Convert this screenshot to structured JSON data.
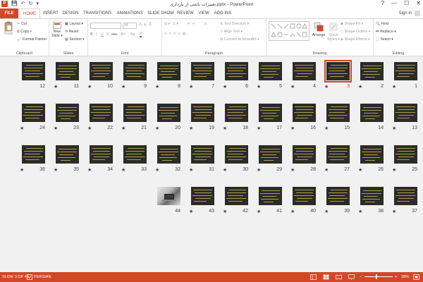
{
  "window": {
    "title": "تغییرات ناشی از بارداری.pptx - PowerPoint",
    "help": "?",
    "min": "—",
    "max": "☐",
    "close": "✕"
  },
  "quick_access": {
    "app_icon": "P",
    "save": "💾",
    "undo": "↶",
    "redo": "↻",
    "customize": "▾"
  },
  "tabs": [
    "FILE",
    "HOME",
    "INSERT",
    "DESIGN",
    "TRANSITIONS",
    "ANIMATIONS",
    "SLIDE SHOW",
    "REVIEW",
    "VIEW",
    "ADD-INS"
  ],
  "sign_in": "Sign in",
  "ribbon": {
    "clipboard": {
      "paste": "Paste",
      "cut": "Cut",
      "copy": "Copy ▾",
      "format_painter": "Format Painter",
      "label": "Clipboard"
    },
    "slides": {
      "new_slide": "New",
      "new_slide2": "Slide ▾",
      "layout": "Layout ▾",
      "reset": "Reset",
      "section": "Section ▾",
      "label": "Slides"
    },
    "font": {
      "size": "44",
      "bold": "B",
      "italic": "I",
      "underline": "U",
      "strike": "S",
      "shadow": "abc",
      "spacing": "AV",
      "case": "Aa",
      "color": "A",
      "grow": "A",
      "shrink": "A",
      "clear": "A",
      "label": "Font"
    },
    "paragraph": {
      "text_direction": "Text Direction ▾",
      "align_text": "Align Text ▾",
      "smartart": "Convert to SmartArt ▾",
      "label": "Paragraph"
    },
    "drawing": {
      "arrange": "Arrange",
      "quick_styles": "Quick",
      "quick_styles2": "Styles ▾",
      "shape_fill": "Shape Fill ▾",
      "shape_outline": "Shape Outline ▾",
      "shape_effects": "Shape Effects ▾",
      "label": "Drawing"
    },
    "editing": {
      "find": "Find",
      "replace": "Replace ▾",
      "select": "Select ▾",
      "label": "Editing"
    }
  },
  "slides": [
    {
      "n": 1,
      "star": true,
      "sel": false,
      "photo": false
    },
    {
      "n": 2,
      "star": true,
      "sel": false,
      "photo": false
    },
    {
      "n": 3,
      "star": true,
      "sel": true,
      "photo": false
    },
    {
      "n": 4,
      "star": true,
      "sel": false,
      "photo": false
    },
    {
      "n": 5,
      "star": true,
      "sel": false,
      "photo": false
    },
    {
      "n": 6,
      "star": true,
      "sel": false,
      "photo": false
    },
    {
      "n": 7,
      "star": true,
      "sel": false,
      "photo": false
    },
    {
      "n": 8,
      "star": true,
      "sel": false,
      "photo": false
    },
    {
      "n": 9,
      "star": true,
      "sel": false,
      "photo": false
    },
    {
      "n": 10,
      "star": true,
      "sel": false,
      "photo": false
    },
    {
      "n": 11,
      "star": true,
      "sel": false,
      "photo": false
    },
    {
      "n": 12,
      "star": false,
      "sel": false,
      "photo": false
    },
    {
      "n": 13,
      "star": true,
      "sel": false,
      "photo": false
    },
    {
      "n": 14,
      "star": false,
      "sel": false,
      "photo": false
    },
    {
      "n": 15,
      "star": true,
      "sel": false,
      "photo": false
    },
    {
      "n": 16,
      "star": true,
      "sel": false,
      "photo": false
    },
    {
      "n": 17,
      "star": true,
      "sel": false,
      "photo": false
    },
    {
      "n": 18,
      "star": true,
      "sel": false,
      "photo": false
    },
    {
      "n": 19,
      "star": true,
      "sel": false,
      "photo": false
    },
    {
      "n": 20,
      "star": true,
      "sel": false,
      "photo": false
    },
    {
      "n": 21,
      "star": true,
      "sel": false,
      "photo": false
    },
    {
      "n": 22,
      "star": true,
      "sel": false,
      "photo": false
    },
    {
      "n": 23,
      "star": true,
      "sel": false,
      "photo": false
    },
    {
      "n": 24,
      "star": true,
      "sel": false,
      "photo": false
    },
    {
      "n": 25,
      "star": true,
      "sel": false,
      "photo": false
    },
    {
      "n": 26,
      "star": true,
      "sel": false,
      "photo": false
    },
    {
      "n": 27,
      "star": true,
      "sel": false,
      "photo": false
    },
    {
      "n": 28,
      "star": true,
      "sel": false,
      "photo": false
    },
    {
      "n": 29,
      "star": true,
      "sel": false,
      "photo": false
    },
    {
      "n": 30,
      "star": true,
      "sel": false,
      "photo": false
    },
    {
      "n": 31,
      "star": true,
      "sel": false,
      "photo": false
    },
    {
      "n": 32,
      "star": true,
      "sel": false,
      "photo": false
    },
    {
      "n": 33,
      "star": true,
      "sel": false,
      "photo": false
    },
    {
      "n": 34,
      "star": true,
      "sel": false,
      "photo": false
    },
    {
      "n": 35,
      "star": true,
      "sel": false,
      "photo": false
    },
    {
      "n": 36,
      "star": true,
      "sel": false,
      "photo": false
    },
    {
      "n": 37,
      "star": true,
      "sel": false,
      "photo": false
    },
    {
      "n": 38,
      "star": true,
      "sel": false,
      "photo": false
    },
    {
      "n": 39,
      "star": true,
      "sel": false,
      "photo": false
    },
    {
      "n": 40,
      "star": true,
      "sel": false,
      "photo": false
    },
    {
      "n": 41,
      "star": true,
      "sel": false,
      "photo": false
    },
    {
      "n": 42,
      "star": true,
      "sel": false,
      "photo": false
    },
    {
      "n": 43,
      "star": true,
      "sel": false,
      "photo": false
    },
    {
      "n": 44,
      "star": false,
      "sel": false,
      "photo": true
    }
  ],
  "status": {
    "slide_of": "SLIDE 3 OF 44",
    "language": "PERSIAN",
    "zoom": "38%"
  },
  "colors": {
    "accent": "#d24726",
    "sorter_bg": "#f1f1f1",
    "thumb_bg": "#2b2b28",
    "thumb_text": "#c8b04a"
  }
}
